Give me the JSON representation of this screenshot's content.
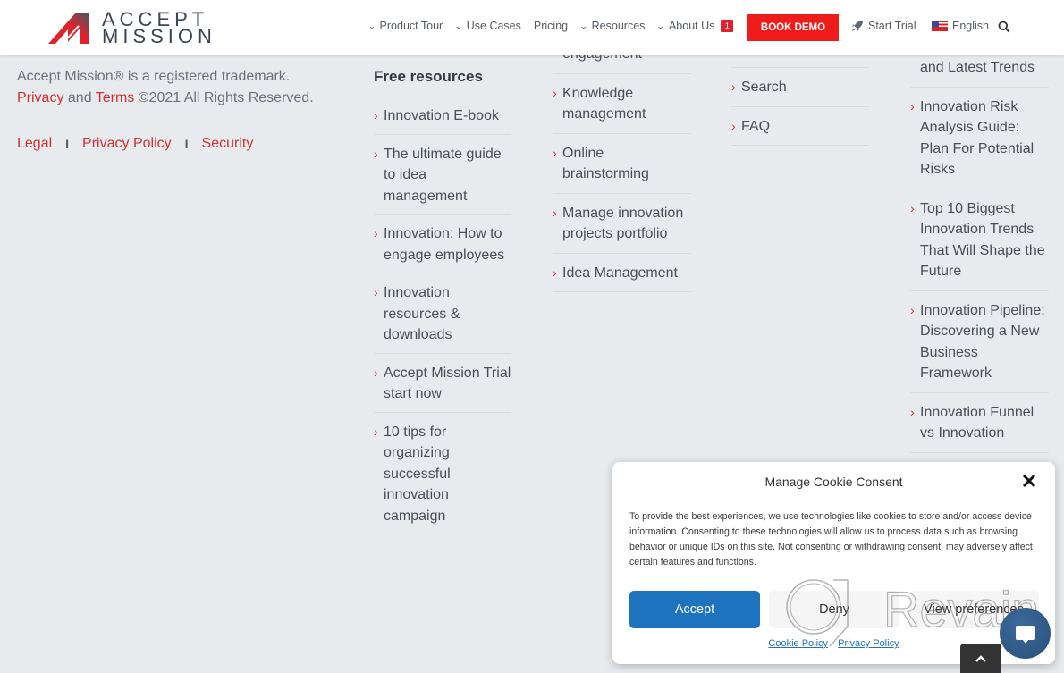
{
  "header": {
    "logo": {
      "line1": "ACCEPT",
      "line2": "MISSION"
    },
    "nav": [
      {
        "label": "Product Tour",
        "has_dropdown": true
      },
      {
        "label": "Use Cases",
        "has_dropdown": true
      },
      {
        "label": "Pricing",
        "has_dropdown": false
      },
      {
        "label": "Resources",
        "has_dropdown": true
      },
      {
        "label": "About Us",
        "has_dropdown": true,
        "badge": "1"
      }
    ],
    "book_demo": "BOOK DEMO",
    "start_trial": "Start Trial",
    "language": "English",
    "icons": {
      "rocket": "rocket-icon",
      "flag": "us-flag-icon",
      "search": "search-icon"
    },
    "colors": {
      "accent": "#ee1c1b",
      "badge": "#e0202a"
    }
  },
  "footer": {
    "copyright": {
      "line1": "Accept Mission® is a registered trademark.",
      "privacy": "Privacy",
      "and": " and ",
      "terms": "Terms",
      "rights": " ©2021 All Rights Reserved."
    },
    "legal_links": [
      {
        "label": "Legal"
      },
      {
        "label": "Privacy Policy"
      },
      {
        "label": "Security"
      }
    ],
    "separator": "I",
    "columns": [
      {
        "title": "Free resources",
        "items": [
          "Innovation E-book",
          "The ultimate guide to idea management",
          "Innovation: How to engage employees",
          "Innovation resources & downloads",
          "Accept Mission Trial start now",
          "10 tips for organizing successful innovation campaign"
        ]
      },
      {
        "partial_top": "engagement",
        "items": [
          "Knowledge management",
          "Online brainstorming",
          "Manage innovation projects portfolio",
          "Idea Management"
        ]
      },
      {
        "items": [
          "Search",
          "FAQ"
        ]
      },
      {
        "partial_top": "and Latest Trends",
        "items": [
          "Innovation Risk Analysis Guide: Plan For Potential Risks",
          "Top 10 Biggest Innovation Trends That Will Shape the Future",
          "Innovation Pipeline: Discovering a New Business Framework",
          "Innovation Funnel vs Innovation"
        ]
      }
    ],
    "link_color": "#d2312f"
  },
  "cookie_dialog": {
    "title": "Manage Cookie Consent",
    "body": "To provide the best experiences, we use technologies like cookies to store and/or access device information. Consenting to these technologies will allow us to process data such as browsing behavior or unique IDs on this site. Not consenting or withdrawing consent, may adversely affect certain features and functions.",
    "accept": "Accept",
    "deny": "Deny",
    "view_preferences": "View preferences",
    "cookie_policy": "Cookie Policy",
    "privacy_policy": "Privacy Policy",
    "accent": "#1e73be"
  },
  "watermark": "Revain"
}
